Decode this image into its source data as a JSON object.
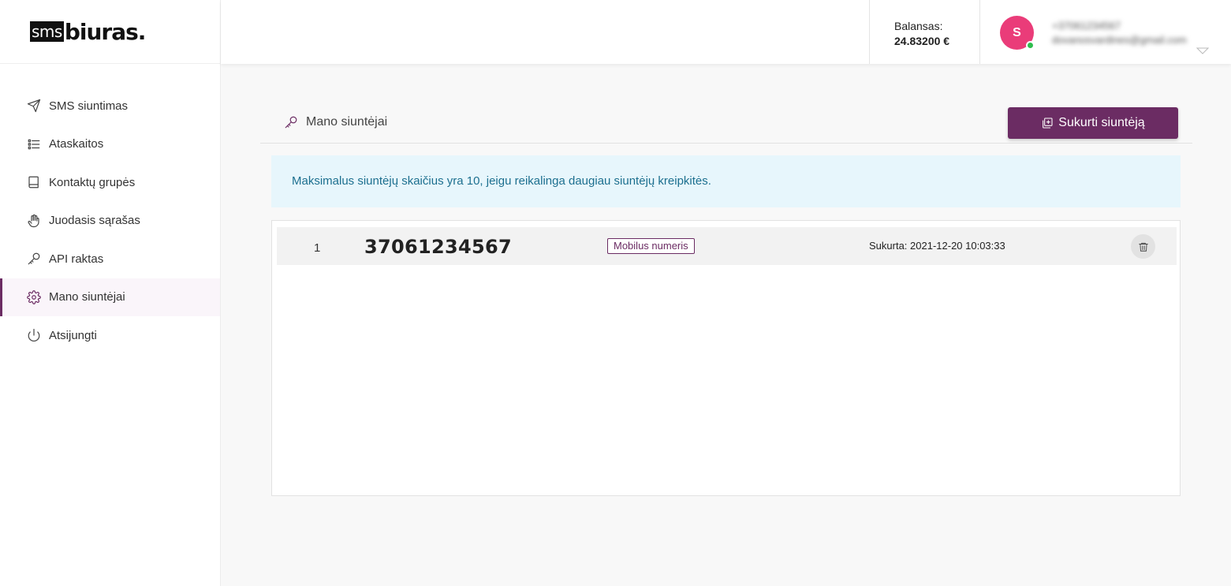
{
  "brand": {
    "logo_sms": "sms",
    "logo_biuras": "biuras."
  },
  "sidebar": {
    "items": [
      {
        "label": "SMS siuntimas",
        "icon": "send-icon",
        "active": false
      },
      {
        "label": "Ataskaitos",
        "icon": "list-icon",
        "active": false
      },
      {
        "label": "Kontaktų grupės",
        "icon": "book-icon",
        "active": false
      },
      {
        "label": "Juodasis sąrašas",
        "icon": "hand-icon",
        "active": false
      },
      {
        "label": "API raktas",
        "icon": "key-icon",
        "active": false
      },
      {
        "label": "Mano siuntėjai",
        "icon": "gear-icon",
        "active": true
      },
      {
        "label": "Atsijungti",
        "icon": "power-icon",
        "active": false
      }
    ]
  },
  "header": {
    "balance_label": "Balansas:",
    "balance_value": "24.83200 €",
    "avatar_initial": "S",
    "user_phone": "+37061234567",
    "user_email": "dovanosvardines@gmail.com"
  },
  "page": {
    "title": "Mano siuntėjai",
    "create_button": "Sukurti siuntėją",
    "info_message": "Maksimalus siuntėjų skaičius yra 10, jeigu reikalinga daugiau siuntėjų kreipkitės."
  },
  "senders": [
    {
      "index": "1",
      "number": "37061234567",
      "type": "Mobilus numeris",
      "created": "Sukurta: 2021-12-20 10:03:33"
    }
  ],
  "colors": {
    "accent": "#6b2c63",
    "avatar": "#ea3c79",
    "info_bg": "#e7f6fc",
    "info_text": "#1c6f8f",
    "online": "#2fbd4e"
  }
}
